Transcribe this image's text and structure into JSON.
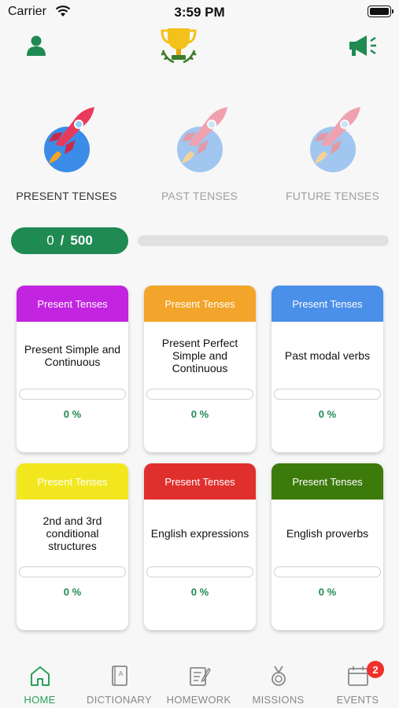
{
  "status_bar": {
    "carrier": "Carrier",
    "time": "3:59 PM"
  },
  "header": {
    "profile_icon": "person-icon",
    "trophy_icon": "trophy-icon",
    "announce_icon": "megaphone-icon",
    "accent": "#1f8a52"
  },
  "categories": [
    {
      "label": "PRESENT TENSES",
      "icon": "rocket-icon",
      "active": true
    },
    {
      "label": "PAST TENSES",
      "icon": "rocket-icon",
      "active": false
    },
    {
      "label": "FUTURE TENSES",
      "icon": "rocket-icon",
      "active": false
    }
  ],
  "progress": {
    "current": "0",
    "separator": "/",
    "max": "500",
    "fraction": 0
  },
  "lessons": [
    {
      "category": "Present Tenses",
      "title": "Present Simple and Continuous",
      "percent": "0 %",
      "color": "#c224e0",
      "progress": 0
    },
    {
      "category": "Present Tenses",
      "title": "Present Perfect Simple and Continuous",
      "percent": "0 %",
      "color": "#f3a42a",
      "progress": 0
    },
    {
      "category": "Present Tenses",
      "title": "Past modal verbs",
      "percent": "0 %",
      "color": "#4a8fe8",
      "progress": 0
    },
    {
      "category": "Present Tenses",
      "title": "2nd and 3rd conditional structures",
      "percent": "0 %",
      "color": "#f2e71f",
      "progress": 0
    },
    {
      "category": "Present Tenses",
      "title": "English expressions",
      "percent": "0 %",
      "color": "#e0302e",
      "progress": 0
    },
    {
      "category": "Present Tenses",
      "title": "English proverbs",
      "percent": "0 %",
      "color": "#3d7a0c",
      "progress": 0
    }
  ],
  "tabs": [
    {
      "label": "HOME",
      "icon": "home-icon",
      "active": true
    },
    {
      "label": "DICTIONARY",
      "icon": "dictionary-icon",
      "active": false
    },
    {
      "label": "HOMEWORK",
      "icon": "homework-icon",
      "active": false
    },
    {
      "label": "MISSIONS",
      "icon": "medal-icon",
      "active": false
    },
    {
      "label": "EVENTS",
      "icon": "calendar-icon",
      "active": false,
      "badge": "2"
    }
  ]
}
